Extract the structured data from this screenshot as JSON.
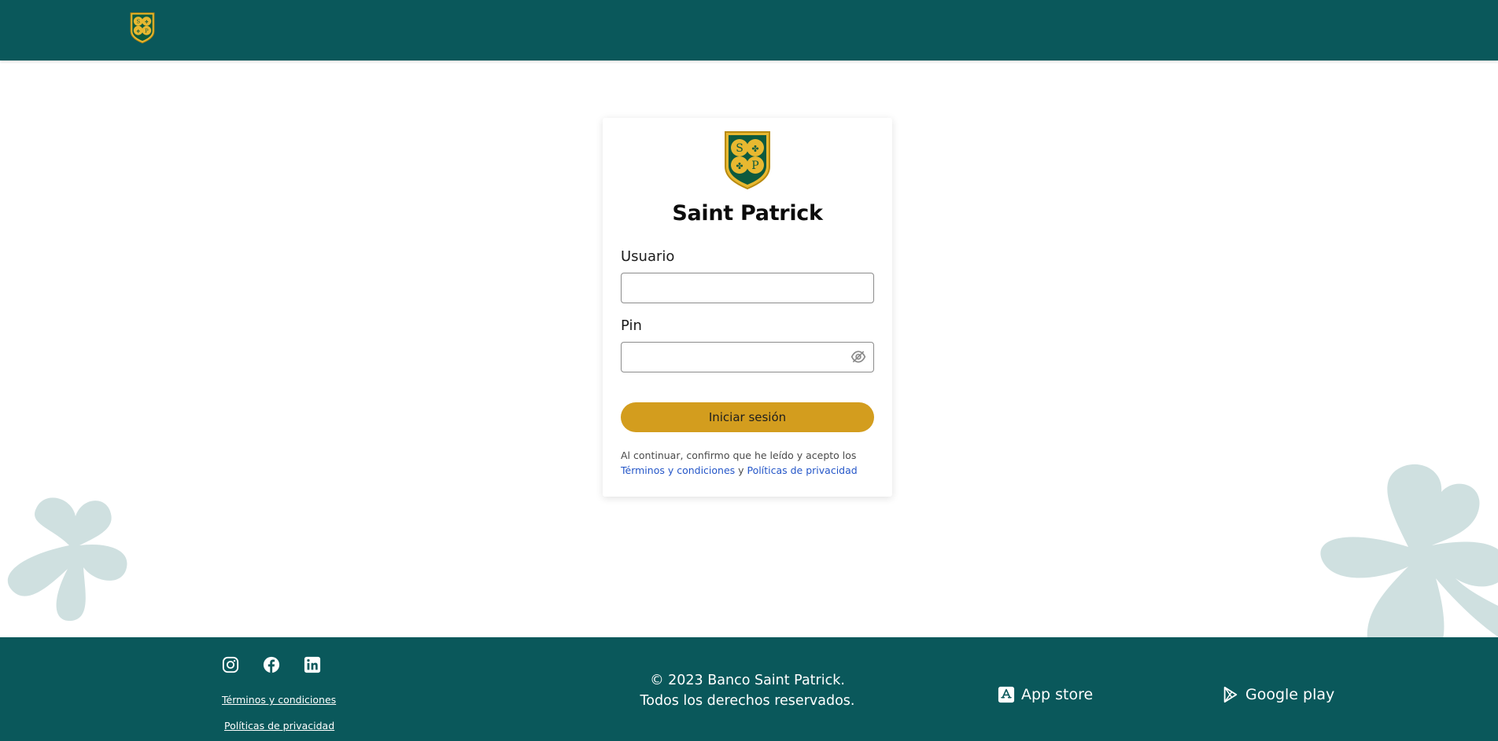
{
  "colors": {
    "brand_teal": "#0a585b",
    "accent_gold": "#d39d1e",
    "clover_decor": "#cfe0e0",
    "link_blue": "#2456c8"
  },
  "header": {
    "logo_icon": "saint-patrick-shield-logo",
    "logo_monogram": "SP"
  },
  "login": {
    "title": "Saint Patrick",
    "username_label": "Usuario",
    "username_value": "",
    "pin_label": "Pin",
    "pin_value": "",
    "pin_toggle_icon": "eye-slash-icon",
    "submit_label": "Iniciar sesión",
    "consent_text": "Al continuar, confirmo que he leído y acepto los",
    "consent_terms_link": "Términos y condiciones",
    "consent_joiner": "y",
    "consent_privacy_link": "Políticas de privacidad"
  },
  "footer": {
    "social_icons": [
      "instagram-icon",
      "facebook-icon",
      "linkedin-icon"
    ],
    "terms_link": "Términos y condiciones",
    "privacy_link": "Políticas de privacidad",
    "copyright_line1": "© 2023 Banco Saint Patrick.",
    "copyright_line2": "Todos los derechos reservados.",
    "app_store_label": "App store",
    "google_play_label": "Google play"
  }
}
